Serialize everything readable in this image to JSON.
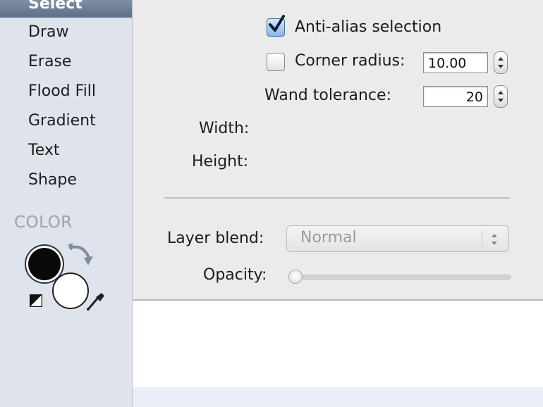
{
  "sidebar": {
    "selected_item": "Select",
    "items": [
      "Draw",
      "Erase",
      "Flood Fill",
      "Gradient",
      "Text",
      "Shape"
    ],
    "color_section_title": "COLOR",
    "foreground_color": "#000000",
    "background_color": "#ffffff",
    "icons": [
      "swap-colors-icon",
      "reset-colors-icon",
      "eyedropper-icon"
    ]
  },
  "options": {
    "anti_alias": {
      "label": "Anti-alias selection",
      "checked": true
    },
    "corner_radius": {
      "label": "Corner radius:",
      "checked": false,
      "value": "10.00"
    },
    "wand_tolerance": {
      "label": "Wand tolerance:",
      "value": "20"
    },
    "width_label": "Width:",
    "height_label": "Height:",
    "layer_blend": {
      "label": "Layer blend:",
      "value": "Normal"
    },
    "opacity": {
      "label": "Opacity:",
      "level": 0
    }
  },
  "colors": {
    "accent": "#5d6f88",
    "checkbox_accent": "#3c6fb0"
  }
}
